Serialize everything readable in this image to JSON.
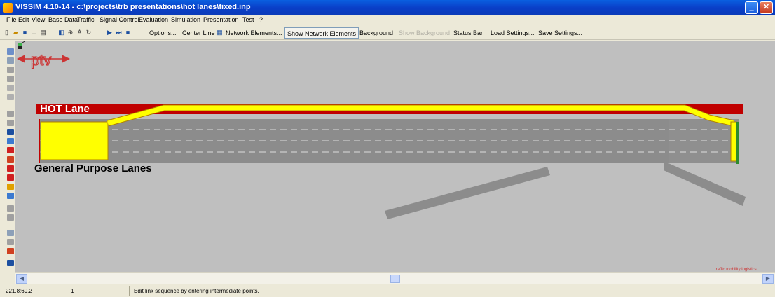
{
  "window": {
    "title": "VISSIM 4.10-14 - c:\\projects\\trb presentations\\hot lanes\\fixed.inp"
  },
  "menu": [
    "File",
    "Edit",
    "View",
    "Base Data",
    "Traffic",
    "Signal Control",
    "Evaluation",
    "Simulation",
    "Presentation",
    "Test",
    "?"
  ],
  "toolbar": {
    "buttons": [
      "Options...",
      "Center Line",
      "Network Elements...",
      "Show Network Elements",
      "Background",
      "Show Background",
      "Status Bar",
      "Load Settings...",
      "Save Settings..."
    ],
    "pressed": "Show Network Elements",
    "disabled": "Show Background"
  },
  "network": {
    "hot_lane_label": "HOT Lane",
    "general_lanes_label": "General Purpose Lanes",
    "colors": {
      "background": "#bfbfbf",
      "road": "#8c8c8c",
      "hot_lane": "#c00000",
      "selected_link": "#ffff00",
      "lane_marking": "#dcdcdc"
    }
  },
  "logo": {
    "text": "ptv",
    "tagline": "traffic mobility logistics"
  },
  "statusbar": {
    "coordinates": "221.8:69.2",
    "count": "1",
    "message": "Edit link sequence by entering intermediate points."
  }
}
